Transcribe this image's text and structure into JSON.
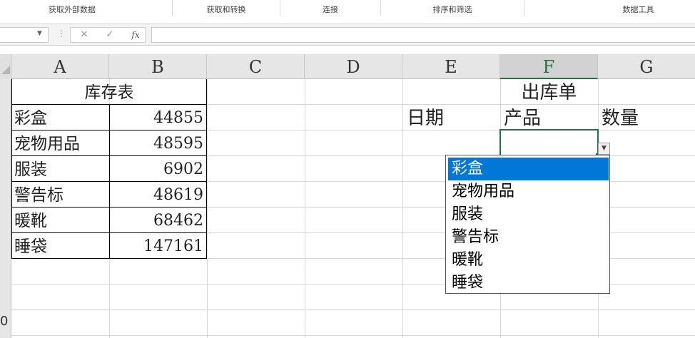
{
  "ribbon": {
    "groups": [
      {
        "label": "获取外部数据"
      },
      {
        "label": "获取和转换"
      },
      {
        "label": "连接"
      },
      {
        "label": "排序和筛选"
      },
      {
        "label": "数据工具"
      }
    ]
  },
  "formula_bar": {
    "cancel_icon": "✕",
    "enter_icon": "✓",
    "fx_icon": "fx",
    "value": ""
  },
  "columns": [
    "A",
    "B",
    "C",
    "D",
    "E",
    "F",
    "G"
  ],
  "selected_column": "F",
  "inventory": {
    "title": "库存表",
    "rows": [
      {
        "name": "彩盒",
        "qty": "44855"
      },
      {
        "name": "宠物用品",
        "qty": "48595"
      },
      {
        "name": "服装",
        "qty": "6902"
      },
      {
        "name": "警告标",
        "qty": "48619"
      },
      {
        "name": "暖靴",
        "qty": "68462"
      },
      {
        "name": "睡袋",
        "qty": "147161"
      }
    ]
  },
  "outbound": {
    "title": "出库单",
    "headers": [
      "日期",
      "产品",
      "数量"
    ]
  },
  "dropdown": {
    "options": [
      "彩盒",
      "宠物用品",
      "服装",
      "警告标",
      "暖靴",
      "睡袋"
    ],
    "selected_index": 0
  },
  "row_header_fragment": "0"
}
